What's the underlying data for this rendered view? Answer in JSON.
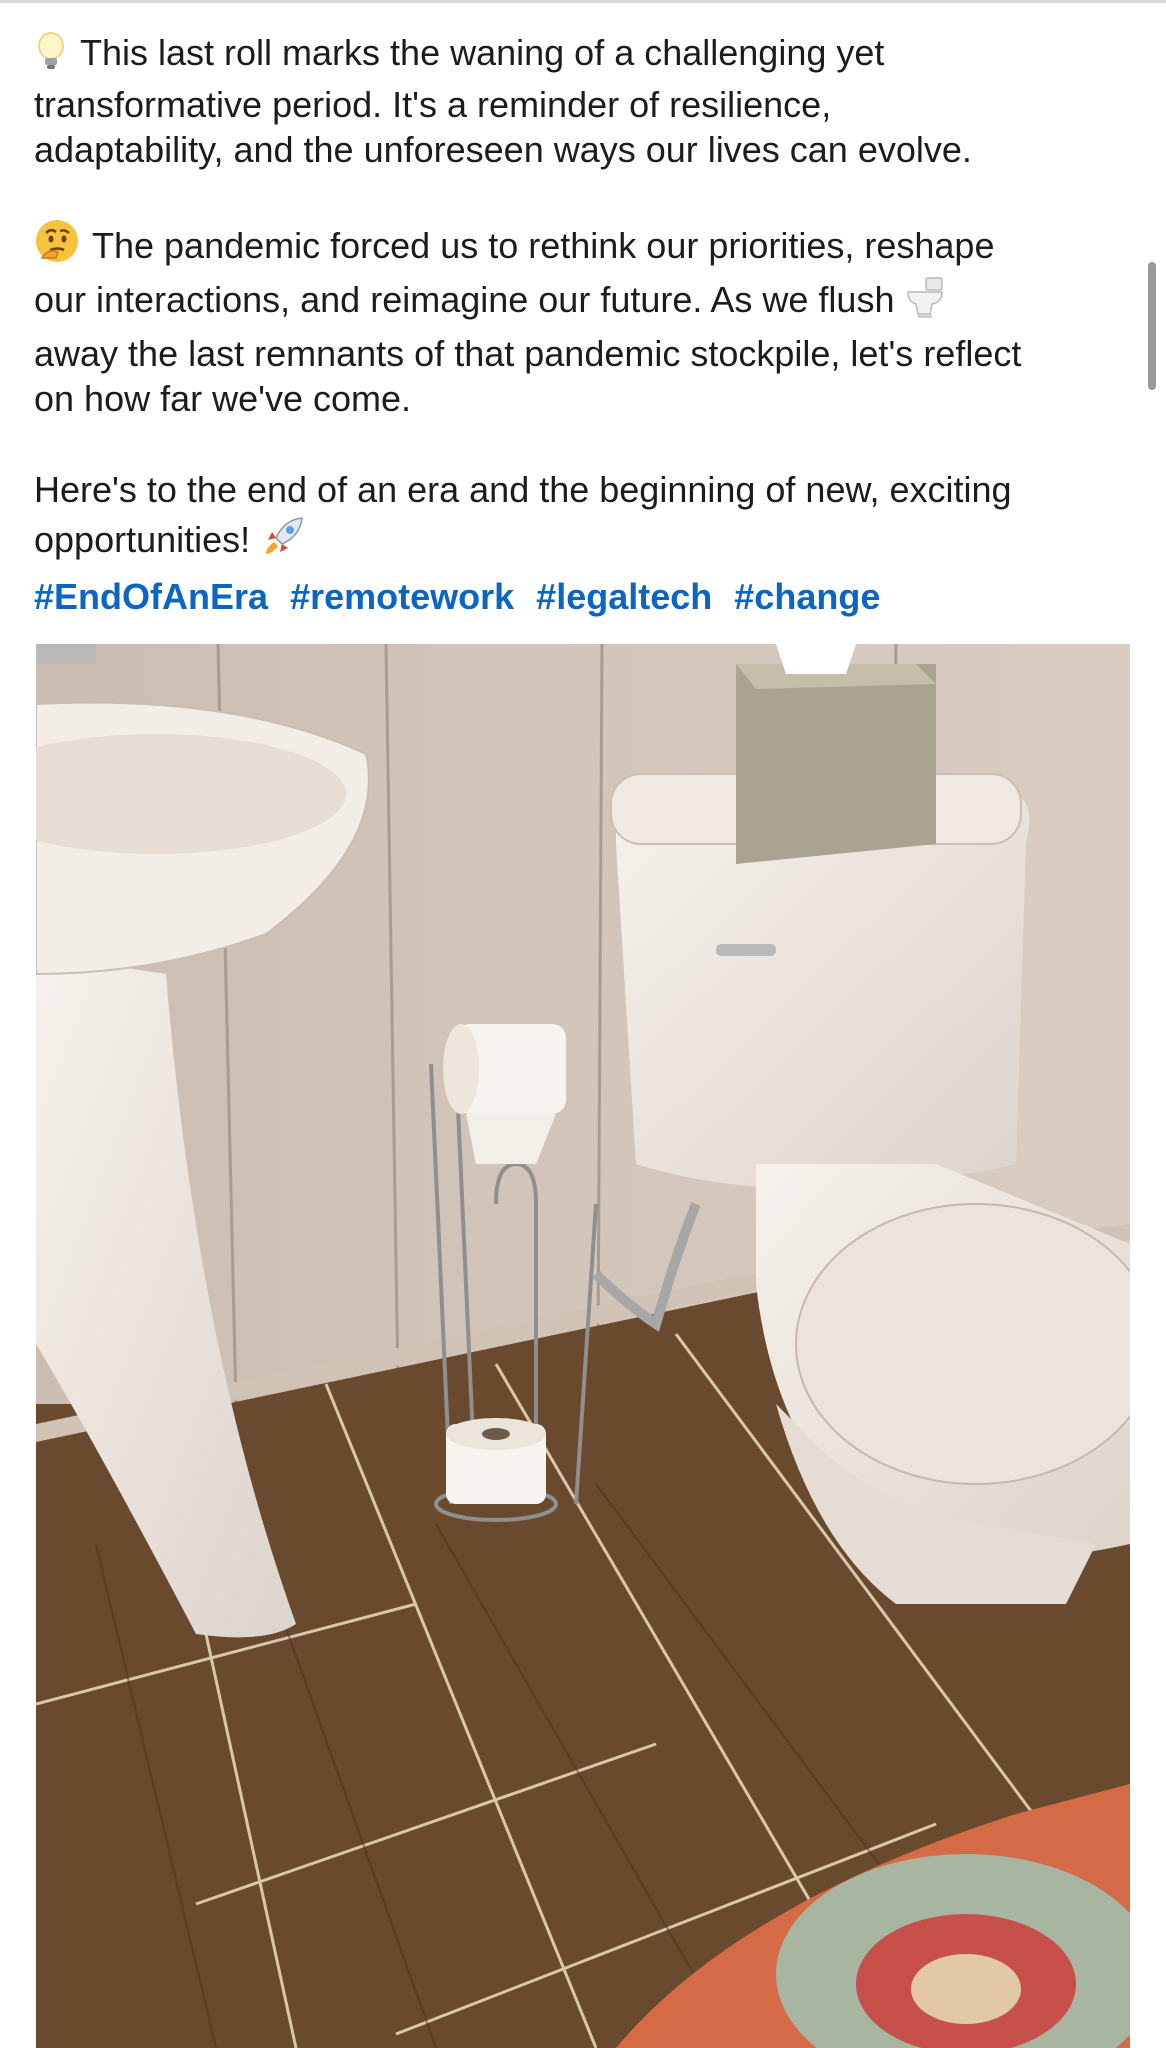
{
  "post": {
    "paragraphs": [
      {
        "emoji": "lightbulb-icon",
        "lines": [
          "This last roll marks the waning of a challenging yet",
          "transformative period. It's a reminder of resilience,",
          "adaptability, and the unforeseen ways our lives can evolve."
        ]
      },
      {
        "emoji": "thinking-face-icon",
        "lines": [
          "The pandemic forced us to rethink our priorities, reshape",
          "our interactions, and reimagine our future. As we flush",
          "away the last remnants of that pandemic stockpile, let's reflect",
          "on how far we've come."
        ],
        "inline_emoji": "toilet-icon"
      },
      {
        "lines": [
          "Here's to the end of an era and the beginning of new, exciting",
          "opportunities!"
        ],
        "inline_emoji": "rocket-icon"
      }
    ],
    "hashtags": [
      "#EndOfAnEra",
      "#remotework",
      "#legaltech",
      "#change"
    ]
  },
  "colors": {
    "text": "#1c1c1c",
    "hashtag": "#0a66c2",
    "background": "#ffffff"
  },
  "image": {
    "subject": "bathroom photo"
  }
}
